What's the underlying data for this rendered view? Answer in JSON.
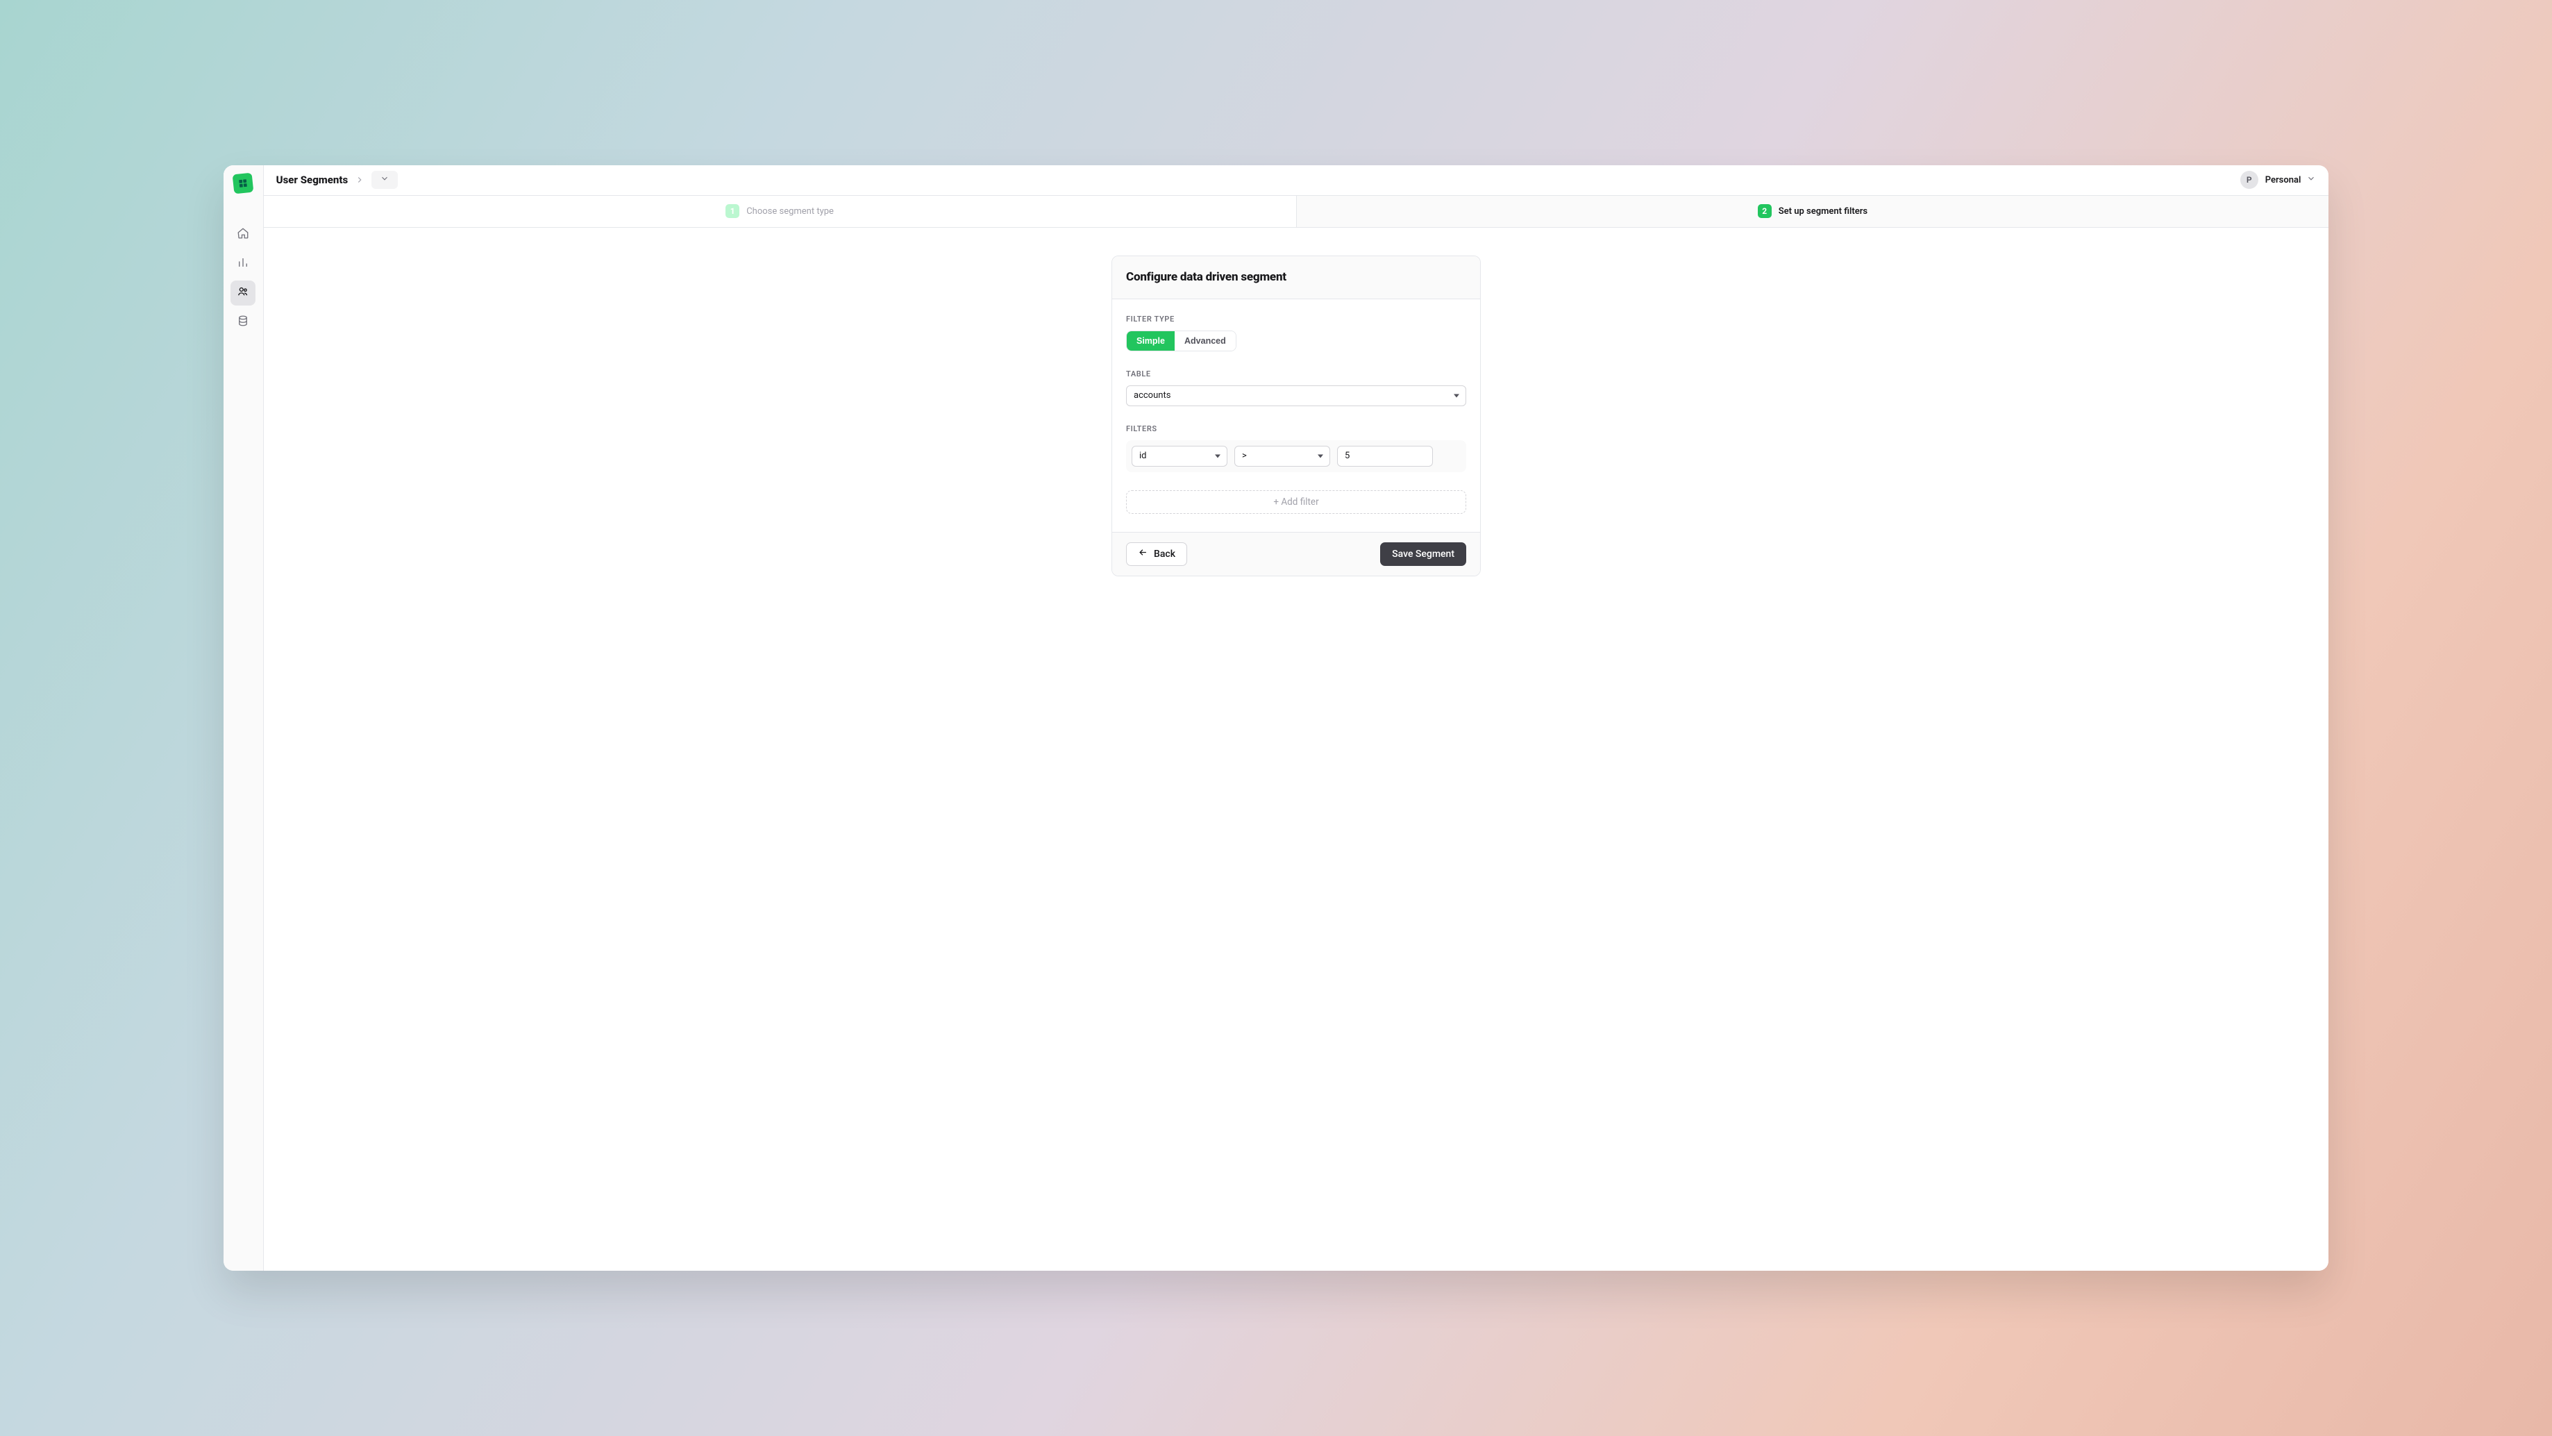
{
  "breadcrumb": {
    "title": "User Segments"
  },
  "workspace": {
    "avatar_initial": "P",
    "name": "Personal"
  },
  "steps": {
    "one": {
      "num": "1",
      "label": "Choose segment type"
    },
    "two": {
      "num": "2",
      "label": "Set up segment filters"
    }
  },
  "form": {
    "title": "Configure data driven segment",
    "filter_type_label": "FILTER TYPE",
    "filter_type": {
      "simple": "Simple",
      "advanced": "Advanced",
      "selected": "simple"
    },
    "table_label": "TABLE",
    "table_value": "accounts",
    "filters_label": "FILTERS",
    "filters": [
      {
        "column": "id",
        "operator": ">",
        "value": "5"
      }
    ],
    "add_filter_label": "+ Add filter"
  },
  "footer": {
    "back": "Back",
    "save": "Save Segment"
  }
}
